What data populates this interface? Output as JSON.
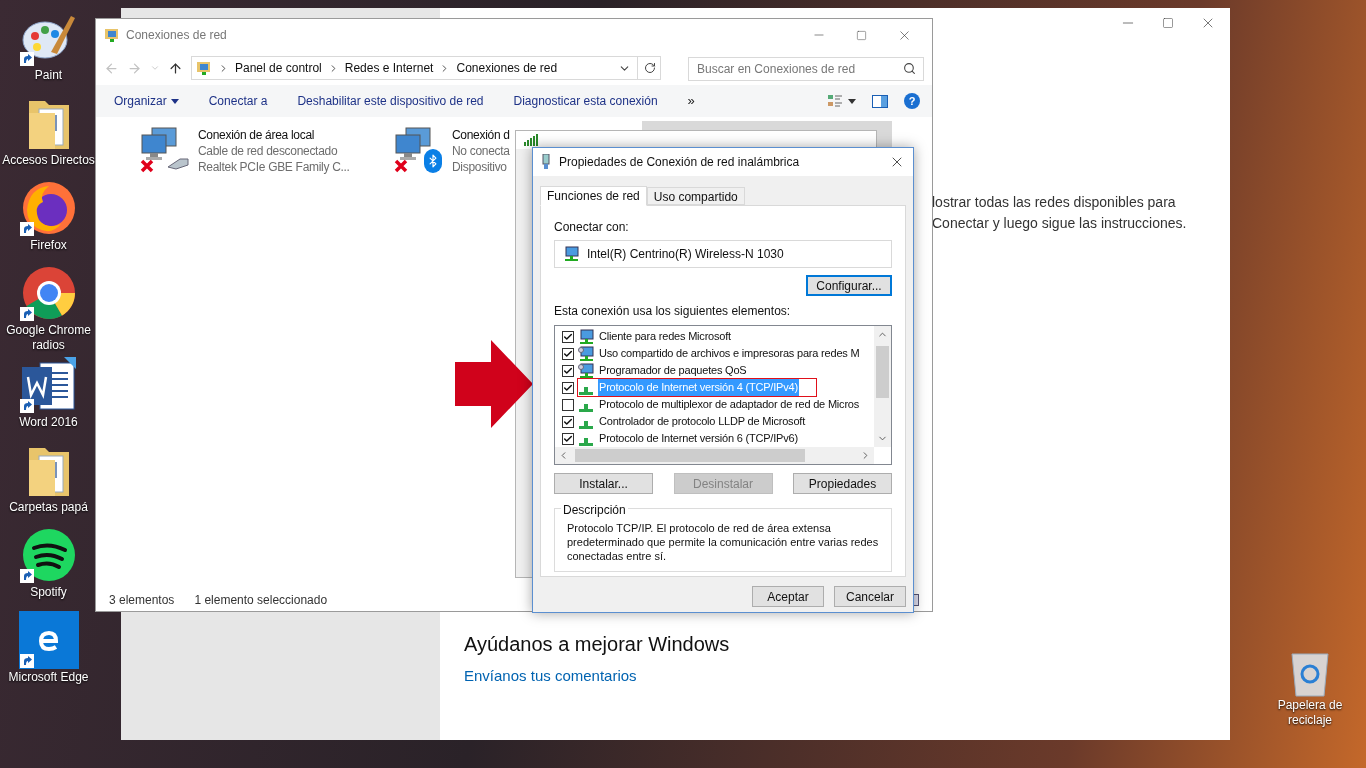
{
  "desktop": {
    "icons": [
      {
        "label": "Paint",
        "kind": "paint",
        "shortcut": true
      },
      {
        "label": "Accesos Directos",
        "kind": "folder",
        "shortcut": false
      },
      {
        "label": "Firefox",
        "kind": "firefox",
        "shortcut": true
      },
      {
        "label": "Google Chrome radios",
        "kind": "chrome",
        "shortcut": true
      },
      {
        "label": "Word 2016",
        "kind": "word",
        "shortcut": true
      },
      {
        "label": "Carpetas papá",
        "kind": "folder",
        "shortcut": false
      },
      {
        "label": "Spotify",
        "kind": "spotify",
        "shortcut": true
      },
      {
        "label": "Microsoft Edge",
        "kind": "edge",
        "shortcut": true
      }
    ],
    "recycle_bin": {
      "label": "Papelera de reciclaje"
    }
  },
  "settings_window": {
    "text_lines": [
      "lostrar todas las redes disponibles para",
      "Conectar y luego sigue las instrucciones."
    ],
    "feedback_heading": "Ayúdanos a mejorar Windows",
    "feedback_link": "Envíanos tus comentarios"
  },
  "explorer": {
    "title": "Conexiones de red",
    "navigation": {
      "back": {
        "disabled": true
      },
      "forward": {
        "disabled": true
      }
    },
    "breadcrumb": [
      "Panel de control",
      "Redes e Internet",
      "Conexiones de red"
    ],
    "search": {
      "placeholder": "Buscar en Conexiones de red"
    },
    "toolbar": [
      {
        "label": "Organizar",
        "dropdown": true
      },
      {
        "label": "Conectar a",
        "dropdown": false
      },
      {
        "label": "Deshabilitar este dispositivo de red",
        "dropdown": false
      },
      {
        "label": "Diagnosticar esta conexión",
        "dropdown": false
      }
    ],
    "overflow": "»",
    "help": "?",
    "items": [
      {
        "name": "Conexión de área local",
        "status": "Cable de red desconectado",
        "device": "Realtek PCIe GBE Family C...",
        "error": true,
        "kind": "cable",
        "selected": false
      },
      {
        "name": "Conexión d",
        "status": "No conecta",
        "device": "Dispositivo",
        "error": true,
        "kind": "bluetooth",
        "selected": false
      },
      {
        "selected": true
      }
    ],
    "status_bar": [
      "3 elementos",
      "1 elemento seleccionado"
    ]
  },
  "properties_dialog": {
    "title": "Propiedades de Conexión de red inalámbrica",
    "tabs": [
      {
        "label": "Funciones de red",
        "selected": true
      },
      {
        "label": "Uso compartido",
        "selected": false
      }
    ],
    "connect_label": "Conectar con:",
    "adapter": "Intel(R) Centrino(R) Wireless-N 1030",
    "configure_button": {
      "label": "Configurar...",
      "focused": true
    },
    "list_label": "Esta conexión usa los siguientes elementos:",
    "list": [
      {
        "label": "Cliente para redes Microsoft",
        "checked": true,
        "selected": false,
        "kind": "client"
      },
      {
        "label": "Uso compartido de archivos e impresoras para redes M",
        "checked": true,
        "selected": false,
        "kind": "service"
      },
      {
        "label": "Programador de paquetes QoS",
        "checked": true,
        "selected": false,
        "kind": "service"
      },
      {
        "label": "Protocolo de Internet versión 4 (TCP/IPv4)",
        "checked": true,
        "selected": true,
        "kind": "protocol"
      },
      {
        "label": "Protocolo de multiplexor de adaptador de red de Micros",
        "checked": false,
        "selected": false,
        "kind": "protocol"
      },
      {
        "label": "Controlador de protocolo LLDP de Microsoft",
        "checked": true,
        "selected": false,
        "kind": "protocol"
      },
      {
        "label": "Protocolo de Internet versión 6 (TCP/IPv6)",
        "checked": true,
        "selected": false,
        "kind": "protocol"
      }
    ],
    "buttons": [
      {
        "label": "Instalar...",
        "disabled": false
      },
      {
        "label": "Desinstalar",
        "disabled": true
      },
      {
        "label": "Propiedades",
        "disabled": false
      }
    ],
    "description": {
      "legend": "Descripción",
      "text": "Protocolo TCP/IP. El protocolo de red de área extensa predeterminado que permite la comunicación entre varias redes conectadas entre sí."
    },
    "footer_buttons": [
      "Aceptar",
      "Cancelar"
    ]
  }
}
